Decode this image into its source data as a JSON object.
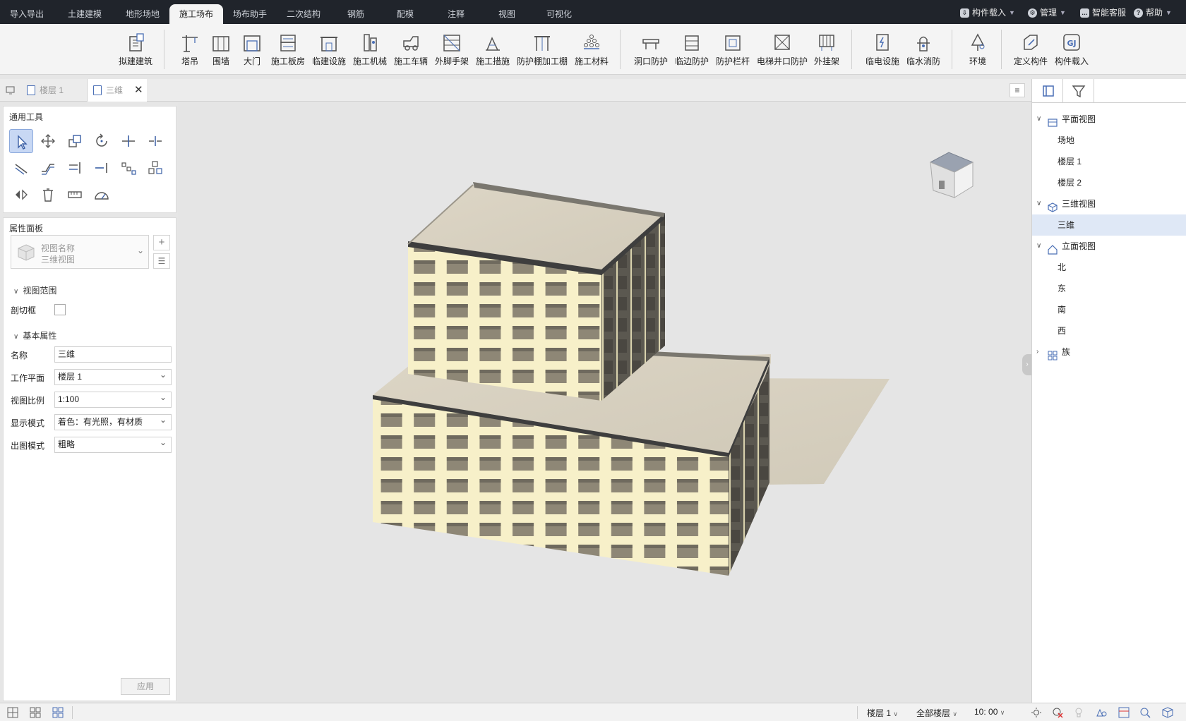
{
  "menu_tabs": [
    "导入导出",
    "土建建模",
    "地形场地",
    "施工场布",
    "场布助手",
    "二次结构",
    "钢筋",
    "配模",
    "注释",
    "视图",
    "可视化"
  ],
  "active_menu_tab": "施工场布",
  "top_right": {
    "load": "构件载入",
    "manage": "管理",
    "service": "智能客服",
    "help": "帮助"
  },
  "ribbon": {
    "group1": [
      "拟建建筑"
    ],
    "group2": [
      "塔吊",
      "围墙",
      "大门",
      "施工板房",
      "临建设施",
      "施工机械",
      "施工车辆",
      "外脚手架",
      "施工措施",
      "防护棚加工棚",
      "施工材料"
    ],
    "group3": [
      "洞口防护",
      "临边防护",
      "防护栏杆",
      "电梯井口防护",
      "外挂架"
    ],
    "group4": [
      "临电设施",
      "临水消防"
    ],
    "group5": [
      "环境"
    ],
    "group6": [
      "定义构件",
      "构件载入"
    ]
  },
  "doc_tabs": [
    {
      "label": "楼层 1",
      "active": false
    },
    {
      "label": "三维",
      "active": true
    }
  ],
  "tools_panel": {
    "title": "通用工具"
  },
  "properties": {
    "title": "属性面板",
    "view_name_label": "视图名称",
    "view_name_value": "三维视图",
    "section_view_range": "视图范围",
    "section_cut_box": "剖切框",
    "section_basic": "基本属性",
    "fields": [
      {
        "label": "名称",
        "value": "三维",
        "dropdown": false
      },
      {
        "label": "工作平面",
        "value": "楼层 1",
        "dropdown": true
      },
      {
        "label": "视图比例",
        "value": "1:100",
        "dropdown": true
      },
      {
        "label": "显示模式",
        "value": "着色：有光照，有材质",
        "dropdown": true
      },
      {
        "label": "出图模式",
        "value": "粗略",
        "dropdown": true
      }
    ],
    "apply": "应用"
  },
  "tree": {
    "plan_views": "平面视图",
    "plan_items": [
      "场地",
      "楼层 1",
      "楼层 2"
    ],
    "3d_views": "三维视图",
    "3d_items": [
      "三维"
    ],
    "elevation_views": "立面视图",
    "elevation_items": [
      "北",
      "东",
      "南",
      "西"
    ],
    "families": "族"
  },
  "status": {
    "floor": "楼层 1",
    "all_floors": "全部楼层",
    "time": "10: 00"
  },
  "colors": {
    "topbar": "#20242b",
    "accent": "#4a6fb5",
    "selection": "#dfe8f6",
    "facade": "#f6efc8",
    "roof": "#d8d2c4"
  }
}
